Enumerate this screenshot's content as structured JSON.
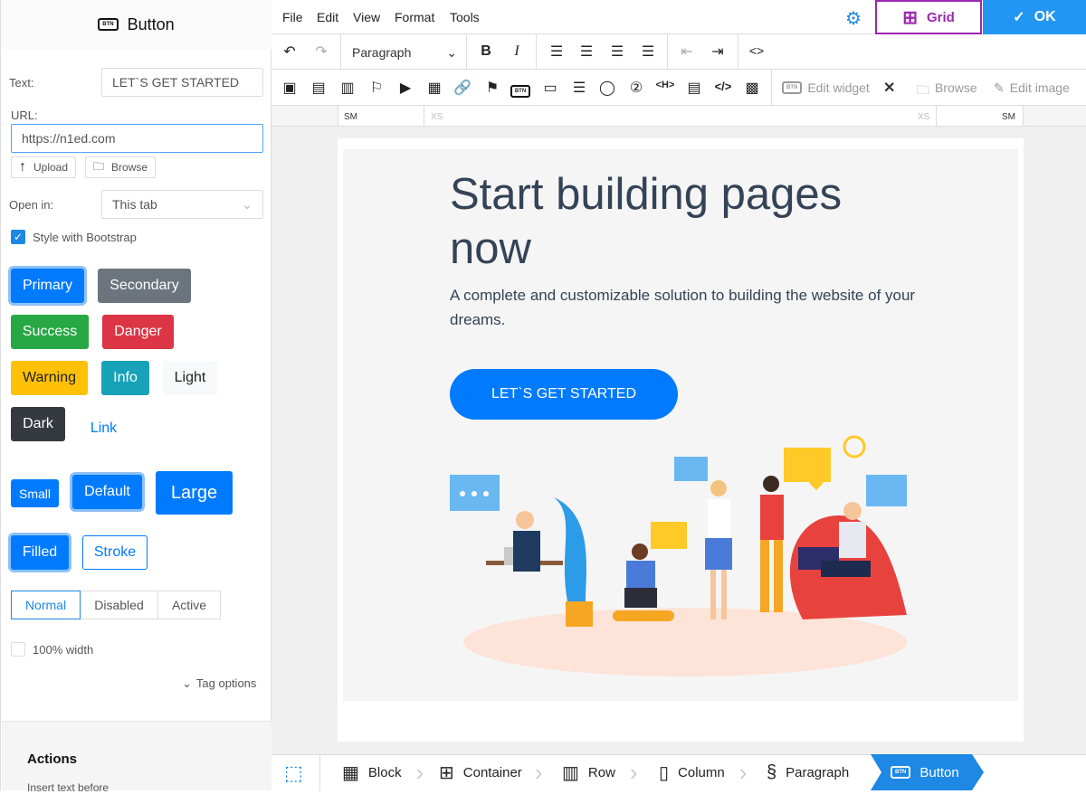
{
  "panel": {
    "title": "Button",
    "icon": "btn-icon",
    "text_label": "Text:",
    "text_value": "LET`S GET STARTED",
    "url_label": "URL:",
    "url_value": "https://n1ed.com",
    "upload": "Upload",
    "browse": "Browse",
    "open_in_label": "Open in:",
    "open_in_value": "This tab",
    "bootstrap_label": "Style with Bootstrap",
    "bootstrap_checked": true,
    "styles": [
      "Primary",
      "Secondary",
      "Success",
      "Danger",
      "Warning",
      "Info",
      "Light",
      "Dark",
      "Link"
    ],
    "sizes": [
      "Small",
      "Default",
      "Large"
    ],
    "fills": [
      "Filled",
      "Stroke"
    ],
    "states": [
      "Normal",
      "Disabled",
      "Active"
    ],
    "full_width_label": "100% width",
    "full_width_checked": false,
    "tag_options": "Tag options",
    "actions_title": "Actions",
    "actions_text": "Insert text before"
  },
  "menu": {
    "items": [
      "File",
      "Edit",
      "View",
      "Format",
      "Tools"
    ],
    "grid": "Grid",
    "ok": "OK"
  },
  "toolbar": {
    "format": "Paragraph",
    "edit_widget": "Edit widget",
    "browse": "Browse",
    "edit_image": "Edit image"
  },
  "ruler": {
    "left": "SM",
    "left2": "XS",
    "right2": "XS",
    "right": "SM"
  },
  "content": {
    "heading": "Start building pages now",
    "text": "A complete and customizable solution to building the website of your dreams.",
    "button": "LET`S GET STARTED"
  },
  "breadcrumb": [
    "Block",
    "Container",
    "Row",
    "Column",
    "Paragraph",
    "Button"
  ],
  "colors": {
    "primary": "#007bff",
    "secondary": "#6c757d",
    "success": "#28a745",
    "danger": "#dc3545",
    "warning": "#ffc107",
    "info": "#17a2b8",
    "light": "#f8f9fa",
    "dark": "#343a40",
    "grid": "#9c27b0",
    "ok": "#2196f3"
  }
}
